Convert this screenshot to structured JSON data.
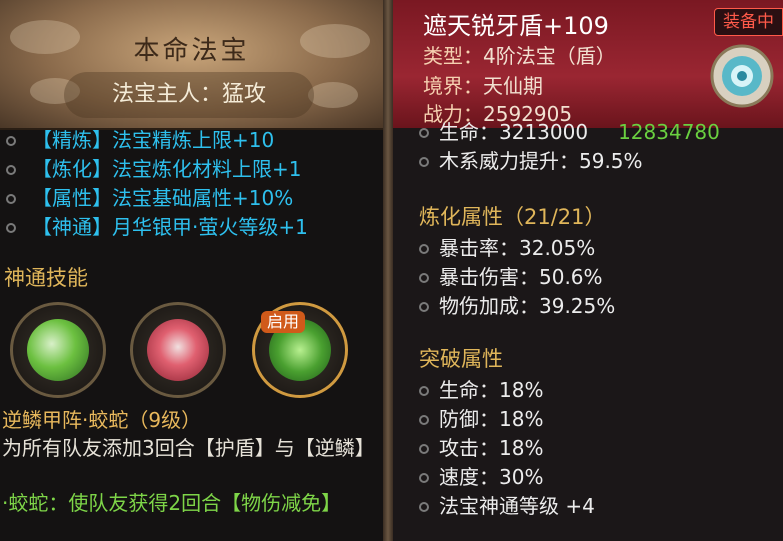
{
  "left": {
    "header": {
      "title": "本命法宝",
      "owner": "法宝主人：猛攻"
    },
    "effects": [
      {
        "text": "【精炼】法宝精炼上限+10"
      },
      {
        "text": "【炼化】法宝炼化材料上限+1"
      },
      {
        "text": "【属性】法宝基础属性+10%"
      },
      {
        "text": "【神通】月华银甲·萤火等级+1"
      }
    ],
    "skills_title": "神通技能",
    "skills": [
      {
        "icon": "green-spiral-skill-icon"
      },
      {
        "icon": "red-spider-skill-icon"
      },
      {
        "icon": "green-sigil-skill-icon",
        "badge": "启用"
      }
    ],
    "skill_name": "逆鳞甲阵·蛟蛇（9级）",
    "skill_desc": "为所有队友添加3回合【护盾】与【逆鳞】",
    "skill_extra": "·蛟蛇：使队友获得2回合【物伤减免】"
  },
  "right": {
    "title": "遮天锐牙盾+109",
    "equip_badge": "装备中",
    "type_label": "类型：",
    "type_value": "4阶法宝（盾）",
    "realm_label": "境界：",
    "realm_value": "天仙期",
    "power_label": "战力：",
    "power_value": "2592905",
    "base_attrs": [
      {
        "label": "生命：",
        "value": "3213000",
        "extra": "12834780"
      },
      {
        "label": "木系威力提升：",
        "value": "59.5%"
      }
    ],
    "refine_title": "炼化属性（21/21）",
    "refine_attrs": [
      {
        "label": "暴击率：",
        "value": "32.05%"
      },
      {
        "label": "暴击伤害：",
        "value": "50.6%"
      },
      {
        "label": "物伤加成：",
        "value": "39.25%"
      }
    ],
    "break_title": "突破属性",
    "break_attrs": [
      {
        "label": "生命：",
        "value": "18%"
      },
      {
        "label": "防御：",
        "value": "18%"
      },
      {
        "label": "攻击：",
        "value": "18%"
      },
      {
        "label": "速度：",
        "value": "30%"
      },
      {
        "label": "法宝神通等级",
        "value": "+4"
      }
    ]
  }
}
